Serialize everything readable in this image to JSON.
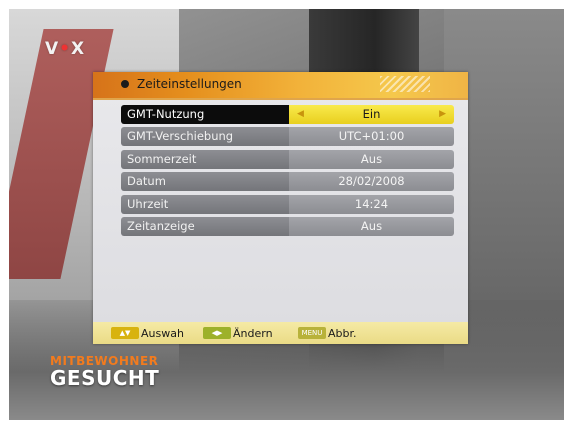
{
  "broadcast": {
    "channel_logo": {
      "left": "V",
      "dot": "•",
      "right": "X"
    },
    "show_logo": {
      "line1": "MITBEWOHNER",
      "line2": "GESUCHT"
    }
  },
  "menu": {
    "title": "Zeiteinstellungen",
    "rows": [
      {
        "label": "GMT-Nutzung",
        "value": "Ein",
        "selected": true
      },
      {
        "label": "GMT-Verschiebung",
        "value": "UTC+01:00",
        "selected": false
      },
      {
        "label": "Sommerzeit",
        "value": "Aus",
        "selected": false
      },
      {
        "label": "Datum",
        "value": "28/02/2008",
        "selected": false
      },
      {
        "label": "Uhrzeit",
        "value": "14:24",
        "selected": false
      },
      {
        "label": "Zeitanzeige",
        "value": "Aus",
        "selected": false
      }
    ],
    "arrows": {
      "left": "◀",
      "right": "▶"
    },
    "hints": [
      {
        "key_color": "yellow",
        "key_text": "▲▼",
        "label": "Auswah"
      },
      {
        "key_color": "green",
        "key_text": "◀▶",
        "label": "Ändern"
      },
      {
        "key_color": "grey",
        "key_text": "MENU",
        "label": "Abbr."
      }
    ]
  }
}
